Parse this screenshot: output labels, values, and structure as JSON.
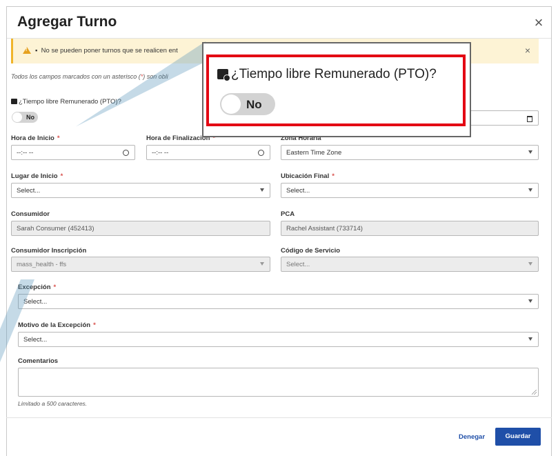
{
  "modal": {
    "title": "Agregar Turno",
    "close_symbol": "×"
  },
  "alert": {
    "bullet": "▪",
    "text": "No se pueden poner turnos que se realicen ent",
    "close_symbol": "×",
    "icon": "warning-icon"
  },
  "note": {
    "text_before": "Todos los campos marcados con un asterisco (",
    "asterisk": "*",
    "text_after": ") son obli"
  },
  "pto": {
    "label": "¿Tiempo libre Remunerado (PTO)?",
    "toggle_value": "No",
    "icon": "briefcase-clock-icon"
  },
  "fields": {
    "hora_inicio": {
      "label": "Hora de Inicio",
      "required_mark": "*",
      "value": "--:-- --"
    },
    "hora_final": {
      "label": "Hora de Finalización",
      "required_mark": "*",
      "value": "--:-- --"
    },
    "zona_horaria": {
      "label": "Zona Horaria",
      "value": "Eastern Time Zone"
    },
    "lugar_inicio": {
      "label": "Lugar de Inicio",
      "required_mark": "*",
      "value": "Select..."
    },
    "ubicacion_final": {
      "label": "Ubicación Final",
      "required_mark": "*",
      "value": "Select..."
    },
    "consumidor": {
      "label": "Consumidor",
      "value": "Sarah Consumer (452413)"
    },
    "pca": {
      "label": "PCA",
      "value": "Rachel Assistant (733714)"
    },
    "consumidor_inscripcion": {
      "label": "Consumidor Inscripción",
      "value": "mass_health - ffs"
    },
    "codigo_servicio": {
      "label": "Código de Servicio",
      "value": "Select..."
    },
    "excepcion": {
      "label": "Excepción",
      "required_mark": "*",
      "value": "Select..."
    },
    "motivo_excepcion": {
      "label": "Motivo de la Excepción",
      "required_mark": "*",
      "value": "Select..."
    },
    "comentarios": {
      "label": "Comentarios",
      "value": "",
      "limit_note": "Limitado a 500 caracteres."
    }
  },
  "footer": {
    "cancel_label": "Denegar",
    "save_label": "Guardar"
  },
  "colors": {
    "primary": "#1f4fa8",
    "alert_bg": "#fdf3d5",
    "required": "#d9534f",
    "callout_border": "#e30613"
  }
}
